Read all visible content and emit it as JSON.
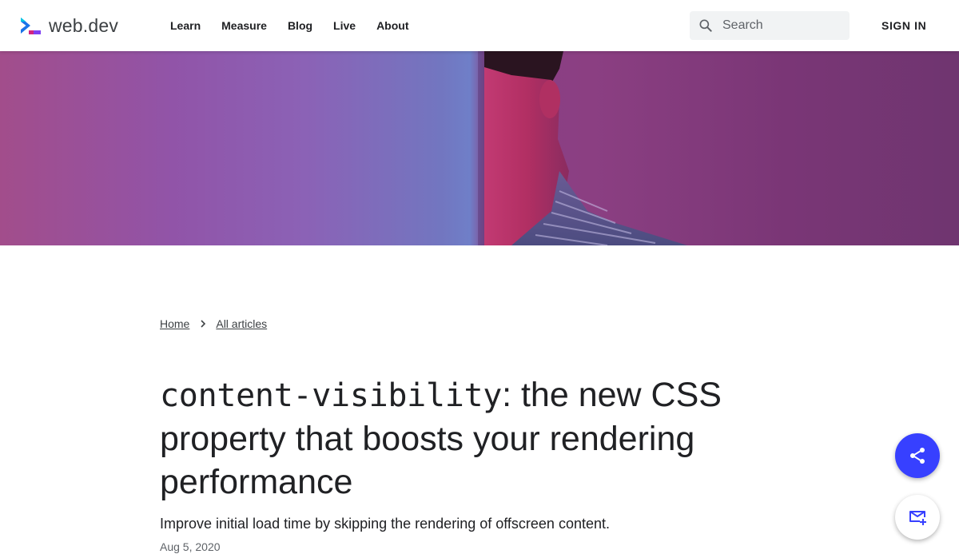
{
  "header": {
    "brand": "web.dev",
    "nav": [
      {
        "label": "Learn"
      },
      {
        "label": "Measure"
      },
      {
        "label": "Blog"
      },
      {
        "label": "Live"
      },
      {
        "label": "About"
      }
    ],
    "search": {
      "placeholder": "Search",
      "value": ""
    },
    "sign_in": "SIGN IN"
  },
  "breadcrumb": [
    {
      "label": "Home"
    },
    {
      "label": "All articles"
    }
  ],
  "article": {
    "title_code": "content-visibility",
    "title_rest": ": the new CSS property that boosts your rendering performance",
    "subtitle": "Improve initial load time by skipping the rendering of offscreen content.",
    "date": "Aug 5, 2020"
  },
  "icons": {
    "brand": "web-dev-logo-icon",
    "search": "search-icon",
    "breadcrumb_separator": "chevron-right-icon",
    "share": "share-icon",
    "subscribe": "mail-add-icon"
  },
  "colors": {
    "accent": "#3740ff",
    "text": "#202124",
    "muted": "#5f6368",
    "search_bg": "#f1f3f4"
  }
}
